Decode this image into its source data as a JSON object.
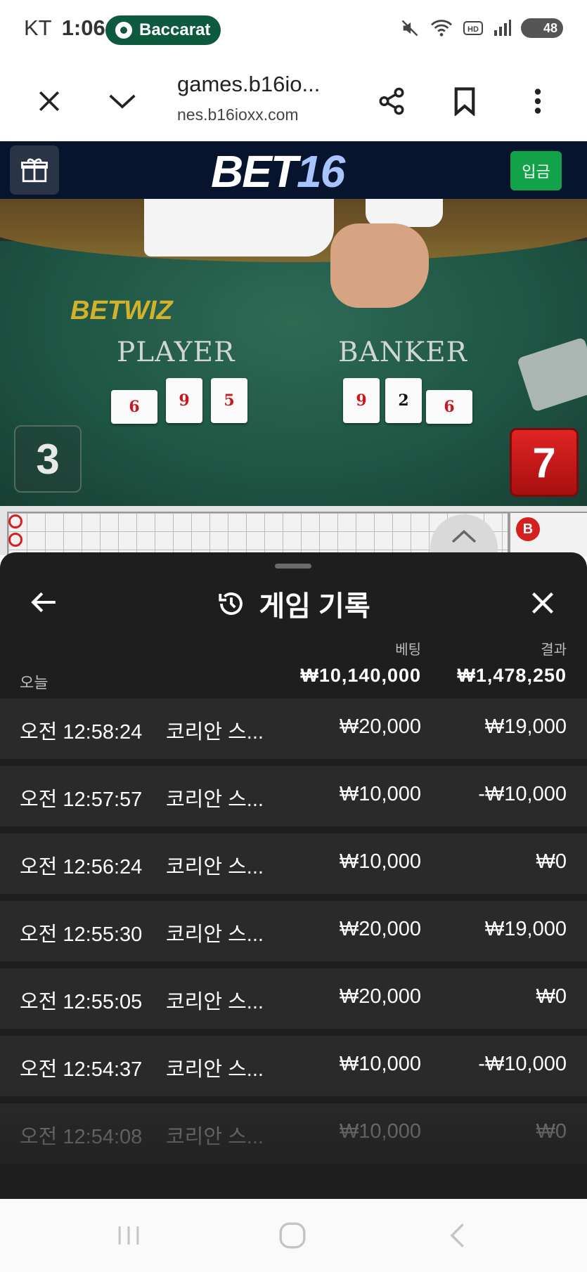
{
  "status_bar": {
    "carrier": "KT",
    "time": "1:06",
    "app_pill": "Baccarat",
    "battery": "48",
    "icons": [
      "mute-icon",
      "wifi-icon",
      "hd-icon",
      "signal-icon",
      "battery-icon"
    ]
  },
  "browser": {
    "domain": "games.b16io...",
    "url": "nes.b16ioxx.com",
    "icons": [
      "close-icon",
      "chevron-down-icon",
      "share-icon",
      "bookmark-icon",
      "more-vert-icon"
    ]
  },
  "site_header": {
    "logo_main": "BET",
    "logo_accent": "16",
    "deposit_label": "입금",
    "icons": [
      "gift-icon"
    ]
  },
  "game": {
    "table_brand": "BETWIZ",
    "player_label": "PLAYER",
    "banker_label": "BANKER",
    "player_cards": [
      "6",
      "9",
      "5"
    ],
    "banker_cards": [
      "9",
      "2",
      "6"
    ],
    "player_score": "3",
    "banker_score": "7"
  },
  "road": {
    "b_label": "B"
  },
  "sheet": {
    "title": "게임 기록",
    "col_bet": "베팅",
    "col_result": "결과",
    "today": "오늘",
    "total_bet": "₩10,140,000",
    "total_result": "₩1,478,250",
    "rows": [
      {
        "time": "오전 12:58:24",
        "game": "코리안 스...",
        "bet": "₩20,000",
        "result": "₩19,000"
      },
      {
        "time": "오전 12:57:57",
        "game": "코리안 스...",
        "bet": "₩10,000",
        "result": "-₩10,000"
      },
      {
        "time": "오전 12:56:24",
        "game": "코리안 스...",
        "bet": "₩10,000",
        "result": "₩0"
      },
      {
        "time": "오전 12:55:30",
        "game": "코리안 스...",
        "bet": "₩20,000",
        "result": "₩19,000"
      },
      {
        "time": "오전 12:55:05",
        "game": "코리안 스...",
        "bet": "₩20,000",
        "result": "₩0"
      },
      {
        "time": "오전 12:54:37",
        "game": "코리안 스...",
        "bet": "₩10,000",
        "result": "-₩10,000"
      },
      {
        "time": "오전 12:54:08",
        "game": "코리안 스...",
        "bet": "₩10,000",
        "result": "₩0"
      }
    ],
    "icons": [
      "back-arrow-icon",
      "history-icon",
      "close-icon"
    ]
  },
  "nav_bar": {
    "icons": [
      "recents-icon",
      "home-icon",
      "back-icon"
    ]
  },
  "colors": {
    "header_bg": "#06142e",
    "deposit_green": "#12a34a",
    "sheet_bg": "#1e1e1e",
    "row_bg": "#2a2a2a",
    "banker_red": "#d62020"
  }
}
